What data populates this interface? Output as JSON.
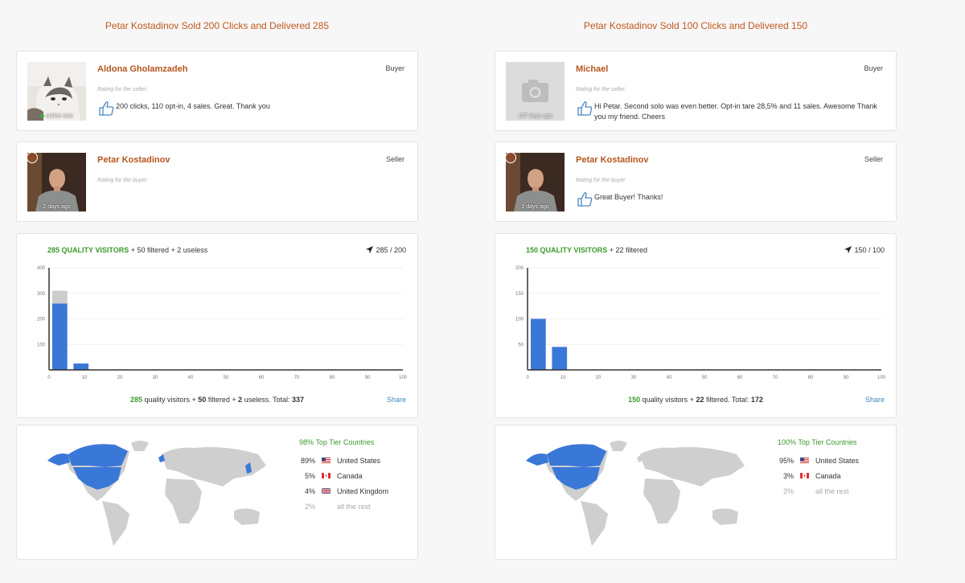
{
  "columns": [
    {
      "title": "Petar Kostadinov Sold 200 Clicks and Delivered 285",
      "buyer_review": {
        "name": "Aldona Gholamzadeh",
        "role": "Buyer",
        "avatar_caption": "online now",
        "rating_label": "Rating for the seller:",
        "text": "200 clicks, 110 opt-in, 4 sales. Great. Thank you"
      },
      "seller_review": {
        "name": "Petar Kostadinov",
        "role": "Seller",
        "avatar_caption": "2 days ago",
        "rating_label": "Rating for the buyer",
        "text": ""
      },
      "stats": {
        "quality_visitors_label": "285 QUALITY VISITORS",
        "filtered_text": " + 50 filtered + 2 useless",
        "ratio": "285 / 200",
        "footer": {
          "quality_count": "285",
          "quality_text": " quality visitors + ",
          "filtered_count": "50",
          "filtered_text": " filtered + ",
          "useless_count": "2",
          "useless_text": " useless. Total: ",
          "total": "337"
        },
        "share_label": "Share"
      },
      "geo": {
        "tier_title": "98% Top Tier Countries",
        "countries": [
          {
            "pct": "89%",
            "name": "United States",
            "flag": "us-flag"
          },
          {
            "pct": "5%",
            "name": "Canada",
            "flag": "ca-flag"
          },
          {
            "pct": "4%",
            "name": "United Kingdom",
            "flag": "uk-flag"
          },
          {
            "pct": "2%",
            "name": "all the rest",
            "flag": ""
          }
        ]
      }
    },
    {
      "title": "Petar Kostadinov Sold 100 Clicks and Delivered 150",
      "buyer_review": {
        "name": "Michael",
        "role": "Buyer",
        "avatar_caption": "107 days ago",
        "rating_label": "Rating for the seller:",
        "text": "Hi Petar. Second solo was even better. Opt-in tare 28,5% and 11 sales. Awesome Thank you my friend. Cheers"
      },
      "seller_review": {
        "name": "Petar Kostadinov",
        "role": "Seller",
        "avatar_caption": "2 days ago",
        "rating_label": "Rating for the buyer",
        "text": "Great Buyer! Thanks!"
      },
      "stats": {
        "quality_visitors_label": "150 QUALITY VISITORS",
        "filtered_text": " + 22 filtered",
        "ratio": "150 / 100",
        "footer": {
          "quality_count": "150",
          "quality_text": " quality visitors + ",
          "filtered_count": "22",
          "filtered_text": " filtered. Total: ",
          "useless_count": "",
          "useless_text": "",
          "total": "172"
        },
        "share_label": "Share"
      },
      "geo": {
        "tier_title": "100% Top Tier Countries",
        "countries": [
          {
            "pct": "95%",
            "name": "United States",
            "flag": "us-flag"
          },
          {
            "pct": "3%",
            "name": "Canada",
            "flag": "ca-flag"
          },
          {
            "pct": "2%",
            "name": "all the rest",
            "flag": ""
          }
        ]
      }
    }
  ],
  "chart_data": [
    {
      "type": "bar",
      "x_ticks": [
        0,
        10,
        20,
        30,
        40,
        50,
        60,
        70,
        80,
        90,
        100
      ],
      "y_ticks": [
        100,
        200,
        300,
        400
      ],
      "ylim": [
        0,
        400
      ],
      "xlim": [
        0,
        100
      ],
      "bin_width": 5,
      "series": [
        {
          "values": [
            {
              "x": 0,
              "y": 260
            },
            {
              "x": 6,
              "y": 25
            }
          ],
          "color": "#3a78d8"
        },
        {
          "values": [
            {
              "x": 0,
              "y": 50
            }
          ],
          "color": "#cccccc",
          "stacked": true
        }
      ]
    },
    {
      "type": "bar",
      "x_ticks": [
        0,
        10,
        20,
        30,
        40,
        50,
        60,
        70,
        80,
        90,
        100
      ],
      "y_ticks": [
        50,
        100,
        150,
        200
      ],
      "ylim": [
        0,
        200
      ],
      "xlim": [
        0,
        100
      ],
      "bin_width": 5,
      "series": [
        {
          "values": [
            {
              "x": 0,
              "y": 100
            },
            {
              "x": 6,
              "y": 45
            }
          ],
          "color": "#3a78d8"
        }
      ]
    }
  ],
  "colors": {
    "accent_orange": "#b5561f",
    "green": "#3a9a2a",
    "bar_blue": "#3a78d8",
    "filtered_grey": "#cccccc",
    "map_highlight": "#3a78d8",
    "map_base": "#cfcfcf"
  }
}
